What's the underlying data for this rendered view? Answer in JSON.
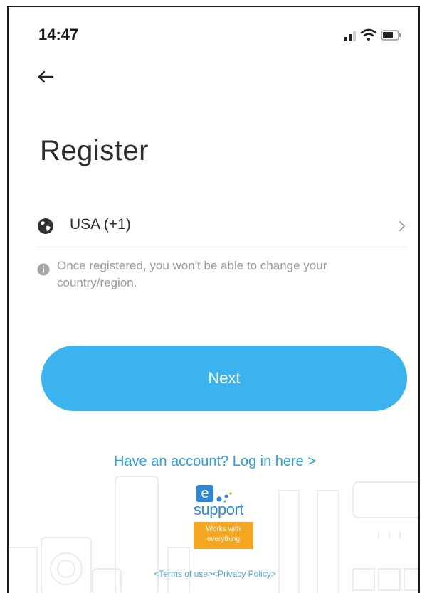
{
  "status_bar": {
    "time": "14:47",
    "icons": [
      "signal-icon",
      "wifi-icon",
      "battery-icon"
    ]
  },
  "nav": {
    "back_icon": "arrow-left-icon"
  },
  "page": {
    "title": "Register"
  },
  "country": {
    "icon": "globe-icon",
    "label": "USA (+1)",
    "chevron": "chevron-right-icon"
  },
  "notice": {
    "icon": "info-icon",
    "text": "Once registered, you won't be able to change your country/region."
  },
  "actions": {
    "next_label": "Next",
    "login_link": "Have an account? Log in here >"
  },
  "branding": {
    "logo_letter": "e",
    "logo_word": "support",
    "tagline_line1": "Works with",
    "tagline_line2": "everything"
  },
  "footer": {
    "terms": "<Terms of use>",
    "privacy": "<Privacy Policy>"
  },
  "colors": {
    "accent": "#3ab3ee",
    "link": "#2b9fe2",
    "brand_blue": "#2f86d6",
    "brand_orange": "#f5a623"
  }
}
